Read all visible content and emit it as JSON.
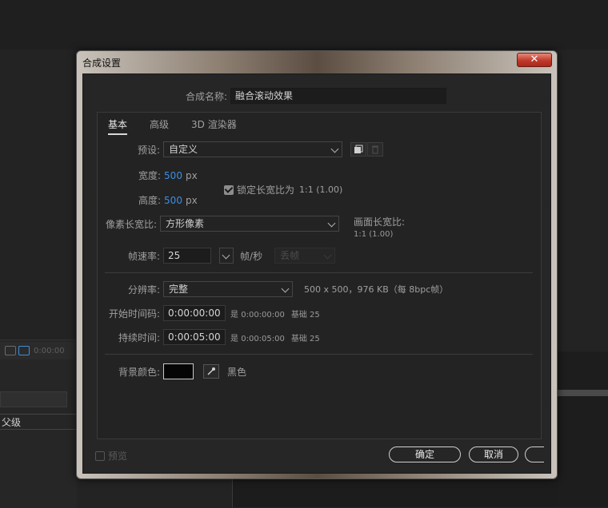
{
  "background": {
    "timecode": "0:00:00",
    "parent_label": "父级"
  },
  "dialog": {
    "title": "合成设置",
    "close_glyph": "✕",
    "comp_name_label": "合成名称:",
    "comp_name_value": "融合滚动效果",
    "tabs": [
      "基本",
      "高级",
      "3D 渲染器"
    ],
    "preset_label": "预设:",
    "preset_value": "自定义",
    "width_label": "宽度:",
    "width_value": "500",
    "height_label": "高度:",
    "height_value": "500",
    "unit_px": "px",
    "lock_aspect_label": "锁定长宽比为",
    "lock_aspect_value": "1:1 (1.00)",
    "pixel_aspect_label": "像素长宽比:",
    "pixel_aspect_value": "方形像素",
    "frame_aspect_label": "画面长宽比:",
    "frame_aspect_value": "1:1 (1.00)",
    "frame_rate_label": "帧速率:",
    "frame_rate_value": "25",
    "frame_rate_unit": "帧/秒",
    "drop_frame_value": "丢帧",
    "resolution_label": "分辨率:",
    "resolution_value": "完整",
    "resolution_info": "500 x 500，976 KB（每 8bpc帧）",
    "start_tc_label": "开始时间码:",
    "start_tc_value": "0:00:00:00",
    "start_tc_info": "是 0:00:00:00",
    "start_tc_base": "基础 25",
    "duration_label": "持续时间:",
    "duration_value": "0:00:05:00",
    "duration_info": "是 0:00:05:00",
    "duration_base": "基础 25",
    "bg_color_label": "背景颜色:",
    "bg_color_name": "黑色",
    "bg_color_hex": "#050505",
    "preview_label": "预览",
    "ok_label": "确定",
    "cancel_label": "取消"
  },
  "icons": [
    "copy-preset-icon",
    "delete-icon",
    "eyedropper-icon",
    "chevron-down-icon",
    "close-icon"
  ]
}
